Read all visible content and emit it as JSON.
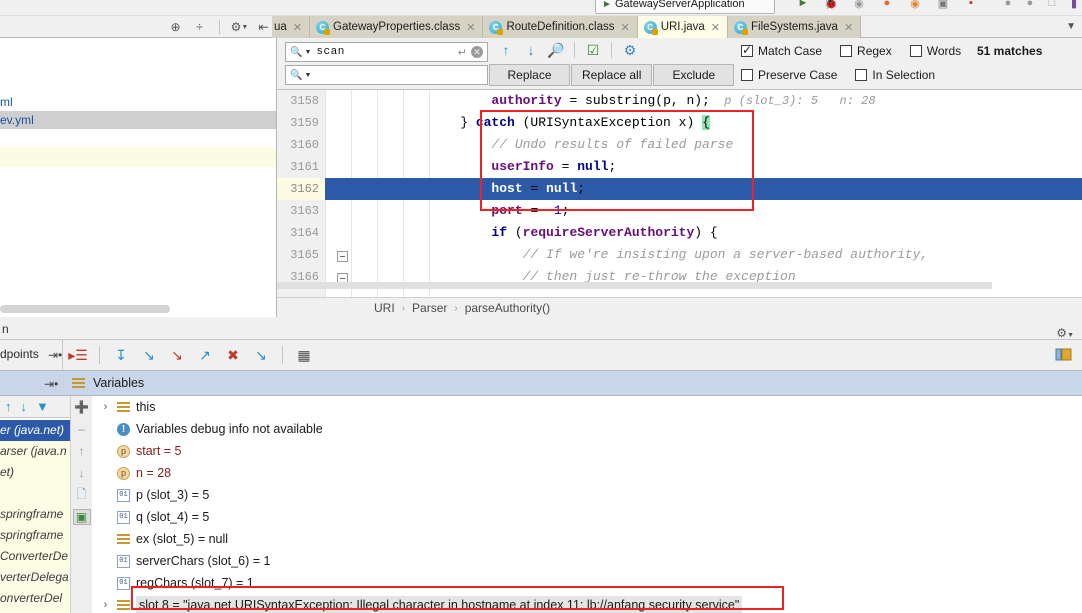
{
  "window": {
    "run_config": "GatewayServerApplication"
  },
  "editor_tabs": [
    {
      "label": "ua",
      "icon": "java-class-icon",
      "active": false,
      "partial": true
    },
    {
      "label": "GatewayProperties.class",
      "icon": "java-class-icon",
      "active": false
    },
    {
      "label": "RouteDefinition.class",
      "icon": "java-class-icon",
      "active": false
    },
    {
      "label": "URI.java",
      "icon": "java-class-icon",
      "active": true
    },
    {
      "label": "FileSystems.java",
      "icon": "java-class-icon",
      "active": false
    }
  ],
  "find": {
    "search_value": "scan",
    "search_placeholder": "",
    "replace_value": "",
    "replace_placeholder": "",
    "buttons": {
      "replace": "Replace",
      "replace_all": "Replace all",
      "exclude": "Exclude"
    },
    "options": [
      {
        "label": "Match Case",
        "checked": true
      },
      {
        "label": "Regex",
        "checked": false
      },
      {
        "label": "Words",
        "checked": false
      },
      {
        "label": "Preserve Case",
        "checked": false
      },
      {
        "label": "In Selection",
        "checked": false
      }
    ],
    "matches": "51 matches",
    "icons": [
      "search-icon",
      "prev-match-icon",
      "next-match-icon",
      "find-all-icon",
      "select-all-occurrences-icon",
      "find-settings-gear-icon"
    ]
  },
  "left_panel": {
    "rows": [
      {
        "label": "ml",
        "state": "normal"
      },
      {
        "label": "ev.yml",
        "state": "selected"
      },
      {
        "label": "",
        "state": "normal"
      },
      {
        "label": "",
        "state": "yellow"
      },
      {
        "label": "",
        "state": "normal"
      }
    ]
  },
  "code": {
    "lines": [
      {
        "num": "3158",
        "tokens": [
          {
            "t": "        ",
            "c": "op"
          },
          {
            "t": "authority",
            "c": "fld2"
          },
          {
            "t": " = ",
            "c": "op"
          },
          {
            "t": "substring",
            "c": "op"
          },
          {
            "t": "(p, n)",
            "c": "op"
          },
          {
            "t": ";",
            "c": "op"
          }
        ],
        "hint": "p (slot_3): 5   n: 28"
      },
      {
        "num": "3159",
        "tokens": [
          {
            "t": "    } ",
            "c": "op"
          },
          {
            "t": "catch",
            "c": "kw"
          },
          {
            "t": " (URISyntaxException x) ",
            "c": "op"
          },
          {
            "t": "{",
            "c": "hilite-brace"
          }
        ],
        "hint": ""
      },
      {
        "num": "3160",
        "tokens": [
          {
            "t": "        // Undo results of failed parse",
            "c": "cmt"
          }
        ],
        "hint": ""
      },
      {
        "num": "3161",
        "tokens": [
          {
            "t": "        ",
            "c": "op"
          },
          {
            "t": "userInfo",
            "c": "fld2"
          },
          {
            "t": " = ",
            "c": "op"
          },
          {
            "t": "null",
            "c": "kw"
          },
          {
            "t": ";",
            "c": "op"
          }
        ],
        "hint": ""
      },
      {
        "num": "3162",
        "tokens": [
          {
            "t": "        ",
            "c": "op"
          },
          {
            "t": "host",
            "c": "fld2"
          },
          {
            "t": " = ",
            "c": "op"
          },
          {
            "t": "null",
            "c": "kw"
          },
          {
            "t": ";",
            "c": "op"
          }
        ],
        "hint": "",
        "selected": true
      },
      {
        "num": "3163",
        "tokens": [
          {
            "t": "        ",
            "c": "op"
          },
          {
            "t": "port",
            "c": "fld2"
          },
          {
            "t": " = ",
            "c": "op"
          },
          {
            "t": "-1",
            "c": "num"
          },
          {
            "t": ";",
            "c": "op"
          }
        ],
        "hint": ""
      },
      {
        "num": "3164",
        "tokens": [
          {
            "t": "        ",
            "c": "op"
          },
          {
            "t": "if",
            "c": "kw"
          },
          {
            "t": " (",
            "c": "op"
          },
          {
            "t": "requireServerAuthority",
            "c": "fld2"
          },
          {
            "t": ") {",
            "c": "op"
          }
        ],
        "hint": ""
      },
      {
        "num": "3165",
        "tokens": [
          {
            "t": "            // If we're insisting upon a server-based authority,",
            "c": "cmt"
          }
        ],
        "hint": ""
      },
      {
        "num": "3166",
        "tokens": [
          {
            "t": "            // then just re-throw the exception",
            "c": "cmt"
          }
        ],
        "hint": ""
      }
    ],
    "breadcrumb": [
      "URI",
      "Parser",
      "parseAuthority()"
    ]
  },
  "debug_toolbar": {
    "label": "dpoints",
    "icons": [
      "resume-program-icon",
      "step-over-icon",
      "step-into-icon",
      "force-step-into-icon",
      "step-out-icon",
      "drop-frame-icon",
      "run-to-cursor-icon",
      "evaluate-expression-icon"
    ],
    "right_icon": "layout-settings-icon"
  },
  "band": {
    "left_label": "n",
    "gear": "settings-gear-icon"
  },
  "variables": {
    "title": "Variables",
    "rows": [
      {
        "caret": "›",
        "icon": "object-icon",
        "text": "this",
        "kind": "object"
      },
      {
        "caret": "",
        "icon": "info-icon",
        "text": "Variables debug info not available",
        "kind": "info"
      },
      {
        "caret": "",
        "icon": "param-icon",
        "name": "start",
        "text": "start = 5",
        "kind": "param"
      },
      {
        "caret": "",
        "icon": "param-icon",
        "name": "n",
        "text": "n = 28",
        "kind": "param"
      },
      {
        "caret": "",
        "icon": "int-icon",
        "text": "p (slot_3) = 5",
        "kind": "local"
      },
      {
        "caret": "",
        "icon": "int-icon",
        "text": "q (slot_4) = 5",
        "kind": "local"
      },
      {
        "caret": "",
        "icon": "object-icon",
        "text": "ex (slot_5) = null",
        "kind": "local"
      },
      {
        "caret": "",
        "icon": "int-icon",
        "text": "serverChars (slot_6) = 1",
        "kind": "local"
      },
      {
        "caret": "",
        "icon": "int-icon",
        "text": "regChars (slot_7) = 1",
        "kind": "local"
      },
      {
        "caret": "›",
        "icon": "object-icon",
        "text": "slot 8 = \"java.net.URISyntaxException: Illegal character in hostname at index 11: lb://anfang security service\"",
        "kind": "highlighted"
      }
    ]
  },
  "frames": {
    "toolbar_icons": [
      "frames-up-icon",
      "frames-down-icon",
      "filter-icon"
    ],
    "rows": [
      {
        "label": "er (java.net)",
        "selected": true
      },
      {
        "label": "arser (java.n",
        "selected": false
      },
      {
        "label": "et)",
        "selected": false
      },
      {
        "label": "",
        "selected": false
      },
      {
        "label": "springframe",
        "selected": false
      },
      {
        "label": "springframe",
        "selected": false
      },
      {
        "label": "ConverterDe",
        "selected": false
      },
      {
        "label": "verterDelega",
        "selected": false
      },
      {
        "label": "onverterDel",
        "selected": false
      }
    ],
    "side_tools": [
      "new-watch-icon",
      "remove-watch-icon",
      "move-up-icon",
      "move-down-icon",
      "copy-icon",
      "inspect-icon"
    ]
  }
}
